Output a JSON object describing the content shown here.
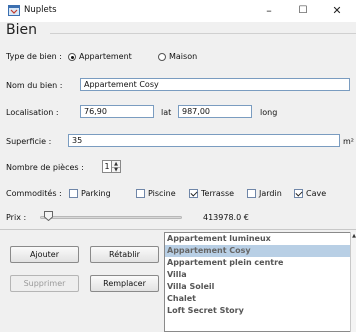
{
  "window": {
    "title": "Nuplets",
    "minimize_glyph": "–",
    "maximize_glyph": "☐",
    "close_glyph": "✕",
    "icon": "java-app-icon"
  },
  "panel": {
    "title": "Bien"
  },
  "form": {
    "type_label": "Type de bien :",
    "type_options": [
      {
        "label": "Appartement",
        "selected": true
      },
      {
        "label": "Maison",
        "selected": false
      }
    ],
    "nom_label": "Nom du bien :",
    "nom_value": "Appartement Cosy",
    "loc_label": "Localisation :",
    "lat_value": "76,90",
    "lat_label": "lat",
    "long_value": "987,00",
    "long_label": "long",
    "superficie_label": "Superficie :",
    "superficie_value": "35",
    "superficie_unit": "m²",
    "pieces_label": "Nombre de pièces :",
    "pieces_value": "1",
    "commodites_label": "Commodités :",
    "commodites": [
      {
        "label": "Parking",
        "checked": false
      },
      {
        "label": "Piscine",
        "checked": false
      },
      {
        "label": "Terrasse",
        "checked": true
      },
      {
        "label": "Jardin",
        "checked": false
      },
      {
        "label": "Cave",
        "checked": true
      }
    ],
    "prix_label": "Prix :",
    "prix_slider_level": 0.03,
    "prix_value": "413978.0 €"
  },
  "buttons": {
    "ajouter": "Ajouter",
    "retablir": "Rétablir",
    "supprimer": "Supprimer",
    "remplacer": "Remplacer"
  },
  "list": {
    "items": [
      "Appartement lumineux",
      "Appartement Cosy",
      "Appartement plein centre",
      "Villa",
      "Villa Soleil",
      "Chalet",
      "Loft Secret Story"
    ],
    "selected_index": 1
  },
  "colors": {
    "selection": "#b8cfe5",
    "field_border": "#7a9cc0"
  }
}
